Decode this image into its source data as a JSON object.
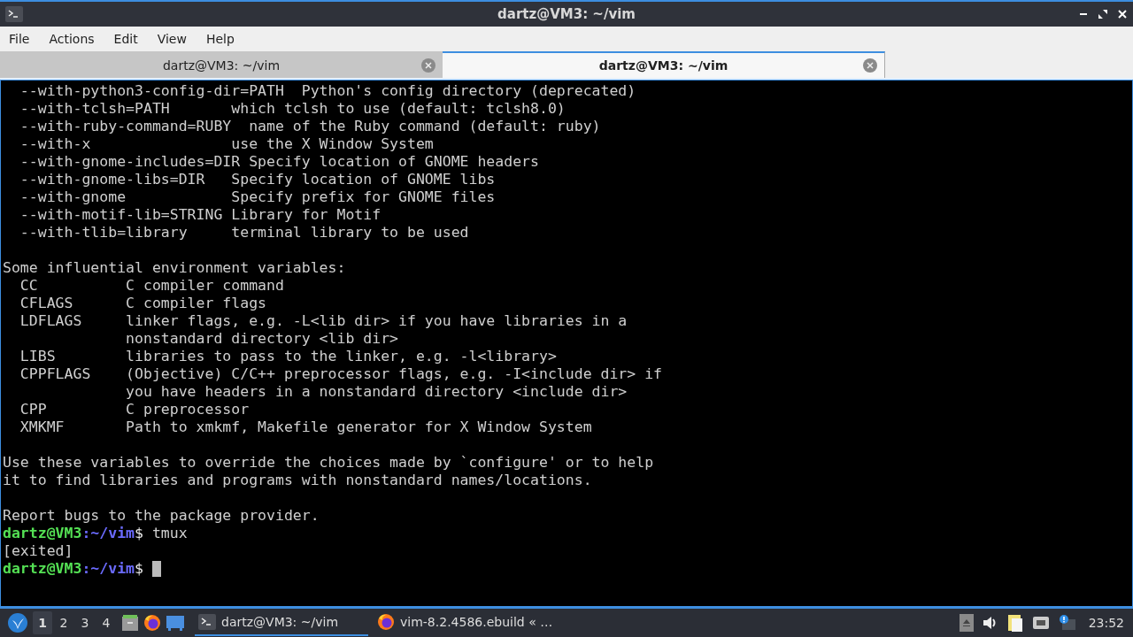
{
  "window": {
    "title": "dartz@VM3: ~/vim"
  },
  "menu": [
    "File",
    "Actions",
    "Edit",
    "View",
    "Help"
  ],
  "tabs": [
    {
      "label": "dartz@VM3: ~/vim",
      "selected": false
    },
    {
      "label": "dartz@VM3: ~/vim",
      "selected": true
    }
  ],
  "terminal": {
    "lines": [
      {
        "kind": "text",
        "text": "  --with-python3-config-dir=PATH  Python's config directory (deprecated)"
      },
      {
        "kind": "text",
        "text": "  --with-tclsh=PATH       which tclsh to use (default: tclsh8.0)"
      },
      {
        "kind": "text",
        "text": "  --with-ruby-command=RUBY  name of the Ruby command (default: ruby)"
      },
      {
        "kind": "text",
        "text": "  --with-x                use the X Window System"
      },
      {
        "kind": "text",
        "text": "  --with-gnome-includes=DIR Specify location of GNOME headers"
      },
      {
        "kind": "text",
        "text": "  --with-gnome-libs=DIR   Specify location of GNOME libs"
      },
      {
        "kind": "text",
        "text": "  --with-gnome            Specify prefix for GNOME files"
      },
      {
        "kind": "text",
        "text": "  --with-motif-lib=STRING Library for Motif"
      },
      {
        "kind": "text",
        "text": "  --with-tlib=library     terminal library to be used"
      },
      {
        "kind": "blank"
      },
      {
        "kind": "text",
        "text": "Some influential environment variables:"
      },
      {
        "kind": "text",
        "text": "  CC          C compiler command"
      },
      {
        "kind": "text",
        "text": "  CFLAGS      C compiler flags"
      },
      {
        "kind": "text",
        "text": "  LDFLAGS     linker flags, e.g. -L<lib dir> if you have libraries in a"
      },
      {
        "kind": "text",
        "text": "              nonstandard directory <lib dir>"
      },
      {
        "kind": "text",
        "text": "  LIBS        libraries to pass to the linker, e.g. -l<library>"
      },
      {
        "kind": "text",
        "text": "  CPPFLAGS    (Objective) C/C++ preprocessor flags, e.g. -I<include dir> if"
      },
      {
        "kind": "text",
        "text": "              you have headers in a nonstandard directory <include dir>"
      },
      {
        "kind": "text",
        "text": "  CPP         C preprocessor"
      },
      {
        "kind": "text",
        "text": "  XMKMF       Path to xmkmf, Makefile generator for X Window System"
      },
      {
        "kind": "blank"
      },
      {
        "kind": "text",
        "text": "Use these variables to override the choices made by `configure' or to help"
      },
      {
        "kind": "text",
        "text": "it to find libraries and programs with nonstandard names/locations."
      },
      {
        "kind": "blank"
      },
      {
        "kind": "text",
        "text": "Report bugs to the package provider."
      },
      {
        "kind": "prompt",
        "user_host": "dartz@VM3",
        "path": ":~/vim",
        "symbol": "$",
        "command": "tmux"
      },
      {
        "kind": "text",
        "text": "[exited]"
      },
      {
        "kind": "prompt",
        "user_host": "dartz@VM3",
        "path": ":~/vim",
        "symbol": "$",
        "cursor": true
      }
    ]
  },
  "taskbar": {
    "desktops": [
      {
        "label": "1",
        "selected": true
      },
      {
        "label": "2",
        "selected": false
      },
      {
        "label": "3",
        "selected": false
      },
      {
        "label": "4",
        "selected": false
      }
    ],
    "tasks": [
      {
        "kind": "terminal",
        "label": "dartz@VM3: ~/vim",
        "selected": true
      },
      {
        "kind": "browser",
        "label": "vim-8.2.4586.ebuild « …",
        "selected": false
      }
    ],
    "clock": "23:52"
  }
}
